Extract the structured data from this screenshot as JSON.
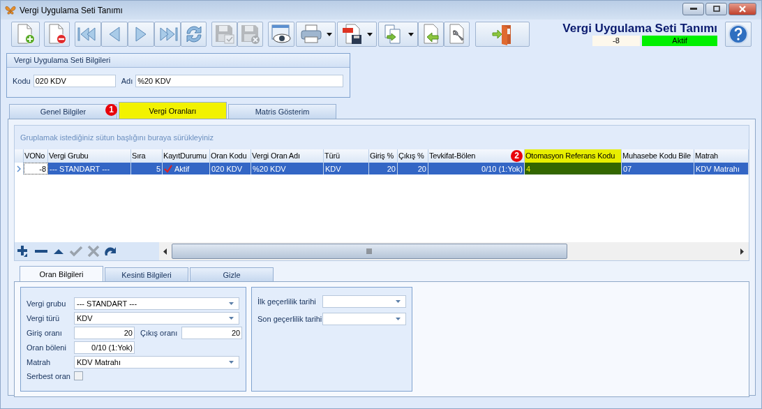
{
  "window": {
    "title": "Vergi Uygulama Seti Tanımı"
  },
  "toolbar": [
    {
      "kind": "new",
      "disabled": false,
      "menu": false
    },
    {
      "kind": "delete",
      "disabled": false,
      "menu": false
    },
    {
      "kind": "first",
      "disabled": false,
      "menu": false
    },
    {
      "kind": "prev",
      "disabled": false,
      "menu": false
    },
    {
      "kind": "next",
      "disabled": false,
      "menu": false
    },
    {
      "kind": "last",
      "disabled": false,
      "menu": false
    },
    {
      "kind": "refresh",
      "disabled": false,
      "menu": false
    },
    {
      "kind": "save",
      "disabled": true,
      "menu": false
    },
    {
      "kind": "cancel",
      "disabled": true,
      "menu": false
    },
    {
      "kind": "preview",
      "disabled": false,
      "menu": false
    },
    {
      "kind": "print",
      "disabled": false,
      "menu": true
    },
    {
      "kind": "pdf",
      "disabled": false,
      "menu": true
    },
    {
      "kind": "copy",
      "disabled": false,
      "menu": true
    },
    {
      "kind": "import",
      "disabled": false,
      "menu": false
    },
    {
      "kind": "tools",
      "disabled": false,
      "menu": false
    },
    {
      "kind": "exit",
      "disabled": false,
      "menu": false
    }
  ],
  "header": {
    "title": "Vergi Uygulama Seti Tanımı",
    "number": "-8",
    "status": "Aktif"
  },
  "info_group": {
    "title": "Vergi Uygulama Seti Bilgileri",
    "fields": [
      {
        "label": "Kodu",
        "value": "020 KDV"
      },
      {
        "label": "Adı",
        "value": "%20 KDV"
      }
    ]
  },
  "tabs": [
    {
      "label": "Genel Bilgiler",
      "selected": false
    },
    {
      "label": "Vergi Oranları",
      "selected": true,
      "badge": "1"
    },
    {
      "label": "Matris Gösterim",
      "selected": false
    }
  ],
  "grid": {
    "group_hint": "Gruplamak istediğiniz sütun başlığını buraya sürükleyiniz",
    "columns": [
      {
        "label": "VONo",
        "numeric": true,
        "highlighted": false
      },
      {
        "label": "Vergi Grubu",
        "numeric": false,
        "highlighted": false
      },
      {
        "label": "Sıra",
        "numeric": true,
        "highlighted": false
      },
      {
        "label": "KayıtDurumu",
        "numeric": false,
        "highlighted": false
      },
      {
        "label": "Oran Kodu",
        "numeric": false,
        "highlighted": false
      },
      {
        "label": "Vergi Oran Adı",
        "numeric": false,
        "highlighted": false
      },
      {
        "label": "Türü",
        "numeric": false,
        "highlighted": false
      },
      {
        "label": "Giriş %",
        "numeric": true,
        "highlighted": false
      },
      {
        "label": "Çıkış %",
        "numeric": true,
        "highlighted": false
      },
      {
        "label": "Tevkifat-Bölen",
        "numeric": true,
        "highlighted": false
      },
      {
        "label": "Otomasyon Referans Kodu",
        "numeric": false,
        "highlighted": true,
        "badge": "2"
      },
      {
        "label": "Muhasebe Kodu Bile",
        "numeric": false,
        "highlighted": false
      },
      {
        "label": "Matrah",
        "numeric": false,
        "highlighted": false
      }
    ],
    "rows": [
      {
        "selected": true,
        "cells": [
          {
            "text": "-8",
            "focused": true
          },
          {
            "text": "--- STANDART ---",
            "focused": false
          },
          {
            "text": "5",
            "focused": false
          },
          {
            "text": "Aktif",
            "checked": true,
            "focused": false
          },
          {
            "text": "020 KDV",
            "focused": false
          },
          {
            "text": "%20 KDV",
            "focused": false
          },
          {
            "text": "KDV",
            "focused": false
          },
          {
            "text": "20",
            "focused": false
          },
          {
            "text": "20",
            "focused": false
          },
          {
            "text": "0/10 (1:Yok)",
            "focused": false
          },
          {
            "text": "4",
            "focused": false
          },
          {
            "text": "07",
            "focused": false
          },
          {
            "text": "KDV Matrahı",
            "focused": false
          }
        ]
      }
    ],
    "navigator": [
      {
        "kind": "add",
        "disabled": false
      },
      {
        "kind": "remove",
        "disabled": false
      },
      {
        "kind": "up",
        "disabled": false
      },
      {
        "kind": "ok",
        "disabled": true
      },
      {
        "kind": "cancel",
        "disabled": true
      },
      {
        "kind": "redo",
        "disabled": false
      }
    ]
  },
  "sub_tabs": [
    {
      "label": "Oran Bilgileri",
      "selected": true
    },
    {
      "label": "Kesinti Bilgileri",
      "selected": false
    },
    {
      "label": "Gizle",
      "selected": false
    }
  ],
  "form_left": [
    {
      "fields": [
        {
          "label": "Vergi grubu",
          "kind": "combo",
          "value": "--- STANDART ---"
        }
      ]
    },
    {
      "fields": [
        {
          "label": "Vergi türü",
          "kind": "combo",
          "value": "KDV"
        }
      ]
    },
    {
      "fields": [
        {
          "label": "Giriş oranı",
          "kind": "number",
          "value": "20"
        },
        {
          "label": "Çıkış oranı",
          "kind": "number",
          "value": "20"
        }
      ]
    },
    {
      "fields": [
        {
          "label": "Oran böleni",
          "kind": "number",
          "value": "0/10 (1:Yok)"
        }
      ]
    },
    {
      "fields": [
        {
          "label": "Matrah",
          "kind": "combo",
          "value": "KDV Matrahı"
        }
      ]
    },
    {
      "fields": [
        {
          "label": "Serbest oran",
          "kind": "checkbox",
          "checked": false
        }
      ]
    }
  ],
  "form_right": [
    {
      "label": "İlk geçerlilik tarihi",
      "kind": "date"
    },
    {
      "label": "Son geçerlilik tarihi",
      "kind": "date"
    }
  ]
}
